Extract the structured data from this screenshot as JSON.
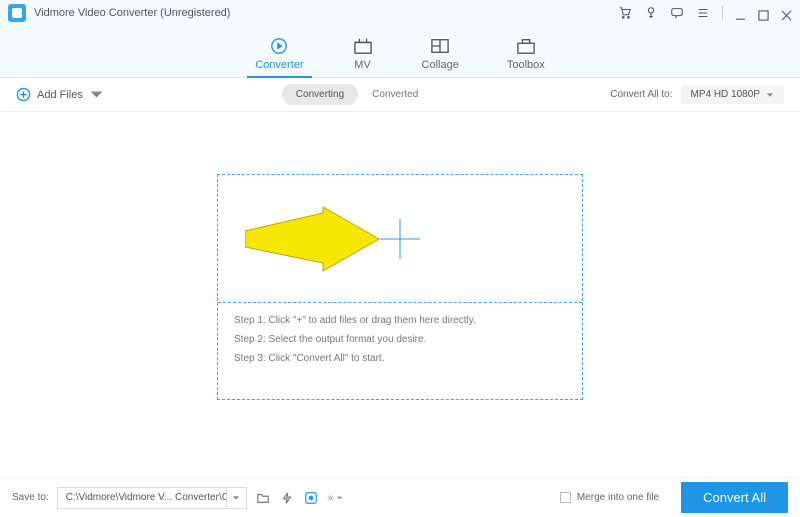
{
  "title": "Vidmore Video Converter (Unregistered)",
  "tabs": {
    "converter": "Converter",
    "mv": "MV",
    "collage": "Collage",
    "toolbox": "Toolbox"
  },
  "toolbar": {
    "add_files": "Add Files",
    "subtabs": {
      "converting": "Converting",
      "converted": "Converted"
    },
    "convert_all_to": "Convert All to:",
    "format": "MP4 HD 1080P"
  },
  "steps": {
    "s1": "Step 1: Click \"+\" to add files or drag them here directly.",
    "s2": "Step 2: Select the output format you desire.",
    "s3": "Step 3: Click \"Convert All\" to start."
  },
  "footer": {
    "save_to": "Save to:",
    "path": "C:\\Vidmore\\Vidmore V... Converter\\Converted",
    "merge": "Merge into one file",
    "convert_all": "Convert All"
  }
}
